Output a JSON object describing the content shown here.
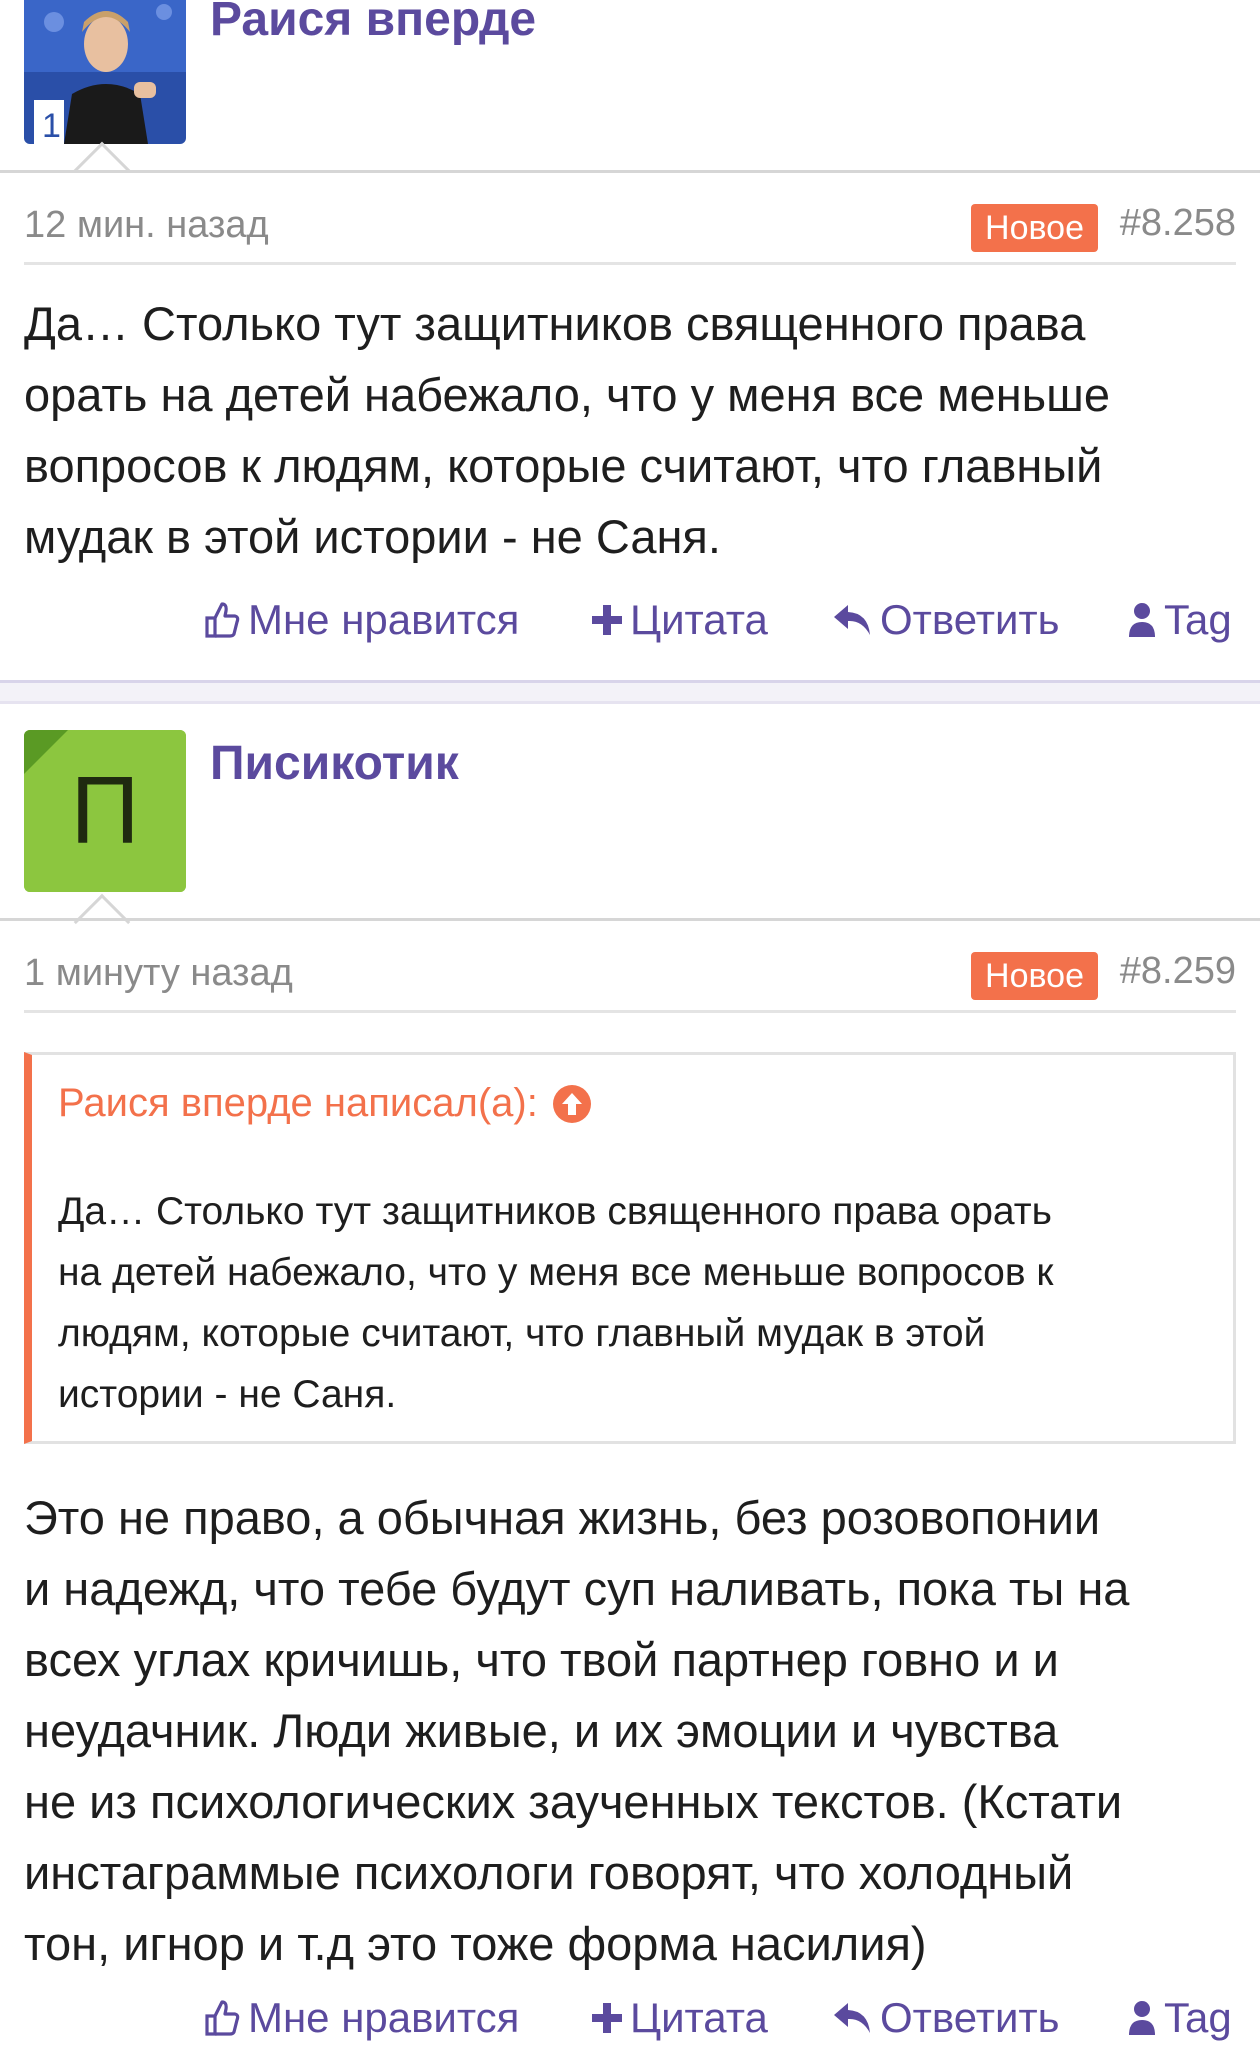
{
  "posts": [
    {
      "author": "Раися вперде",
      "time": "12 мин. назад",
      "badge": "Новое",
      "number": "#8.258",
      "lines": [
        "Да… Столько тут защитников священного права",
        "орать на детей набежало, что у меня все меньше",
        "вопросов к людям, которые считают, что главный",
        "мудак в этой истории - не Саня."
      ]
    },
    {
      "author": "Писикотик",
      "avatar_letter": "П",
      "avatar_color": "#8cc63f",
      "time": "1 минуту назад",
      "badge": "Новое",
      "number": "#8.259",
      "quote": {
        "header": "Раися вперде написал(а):",
        "lines": [
          "Да… Столько тут защитников священного права орать",
          "на детей набежало, что у меня все меньше вопросов к",
          "людям, которые считают, что главный мудак в этой",
          "истории - не Саня."
        ]
      },
      "lines": [
        "Это не право, а обычная жизнь, без розовопонии",
        "и надежд, что тебе будут суп наливать, пока ты на",
        "всех углах кричишь, что твой партнер говно и и",
        "неудачник. Люди живые, и их эмоции и чувства",
        "не из психологических заученных текстов. (Кстати",
        "инстаграммые психологи говорят, что холодный",
        "тон, игнор и т.д это тоже форма насилия)"
      ]
    }
  ],
  "actions": {
    "like": "Мне нравится",
    "quote": "Цитата",
    "reply": "Ответить",
    "tag": "Tag"
  },
  "colors": {
    "accent": "#5b4a9e",
    "badge": "#f3714b",
    "quote_border": "#f3714b"
  }
}
